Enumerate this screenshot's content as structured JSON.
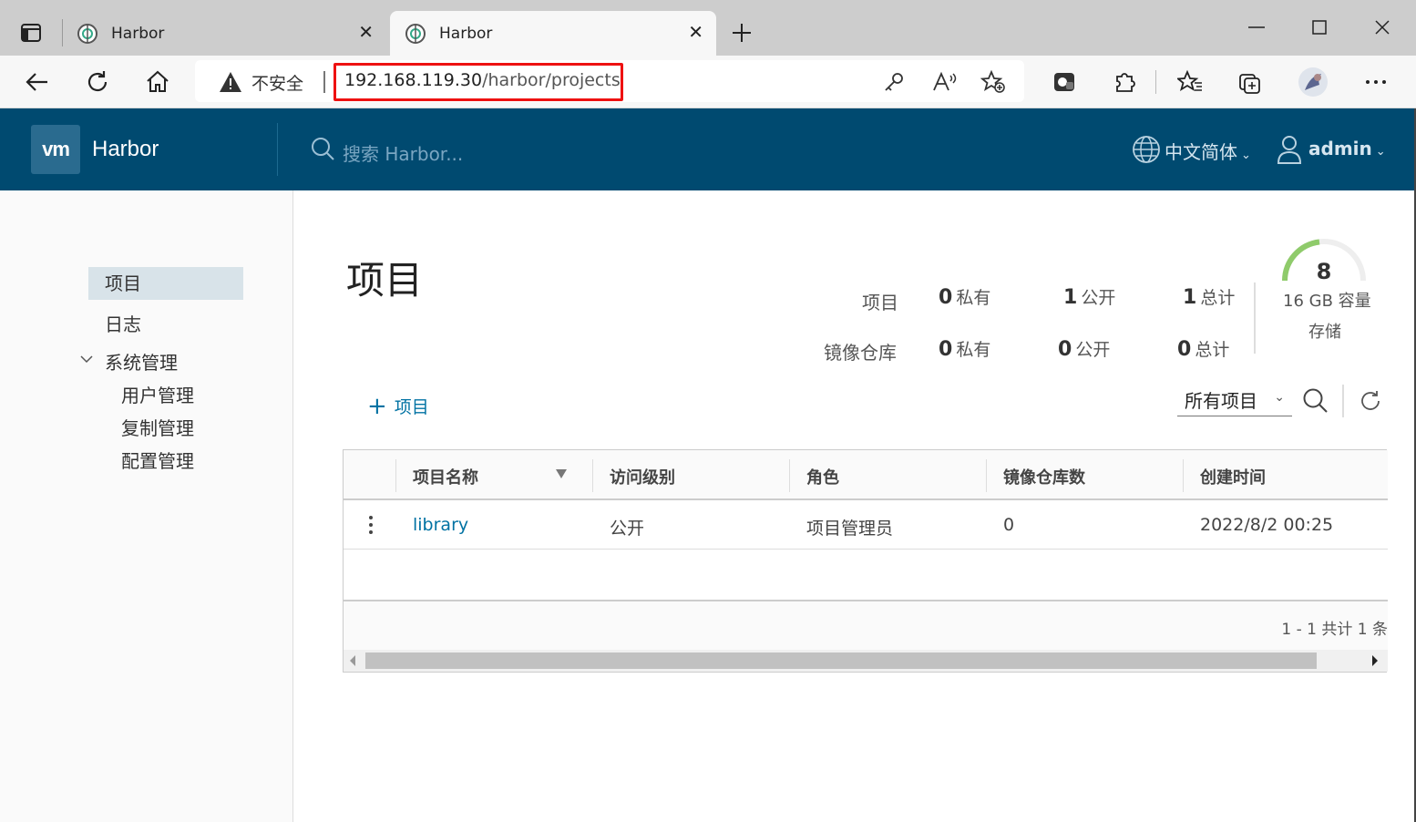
{
  "browser": {
    "tabs": [
      {
        "title": "Harbor"
      },
      {
        "title": "Harbor"
      }
    ],
    "insecure_label": "不安全",
    "url_host": "192.168.119.30",
    "url_path": "/harbor/projects"
  },
  "header": {
    "logo_text": "vm",
    "brand": "Harbor",
    "search_placeholder": "搜索 Harbor...",
    "language": "中文简体",
    "user": "admin"
  },
  "sidebar": {
    "items": [
      {
        "label": "项目",
        "active": true
      },
      {
        "label": "日志"
      },
      {
        "label": "系统管理"
      }
    ],
    "sub_items": [
      {
        "label": "用户管理"
      },
      {
        "label": "复制管理"
      },
      {
        "label": "配置管理"
      }
    ]
  },
  "page": {
    "title": "项目",
    "stats": {
      "projects_label": "项目",
      "repos_label": "镜像仓库",
      "private_label": "私有",
      "public_label": "公开",
      "total_label": "总计",
      "projects_private": "0",
      "projects_public": "1",
      "projects_total": "1",
      "repos_private": "0",
      "repos_public": "0",
      "repos_total": "0"
    },
    "storage": {
      "used": "8",
      "capacity": "16 GB 容量",
      "label": "存储"
    },
    "new_project_label": "项目",
    "filter_value": "所有项目"
  },
  "table": {
    "columns": [
      "项目名称",
      "访问级别",
      "角色",
      "镜像仓库数",
      "创建时间"
    ],
    "rows": [
      {
        "name": "library",
        "access": "公开",
        "role": "项目管理员",
        "repo_count": "0",
        "created": "2022/8/2 00:25"
      }
    ],
    "pagination": "1 - 1 共计 1 条"
  },
  "colors": {
    "header_bg": "#004a70",
    "link": "#0072a3",
    "gauge": "#8fcb6b",
    "url_highlight": "#ee1111"
  }
}
